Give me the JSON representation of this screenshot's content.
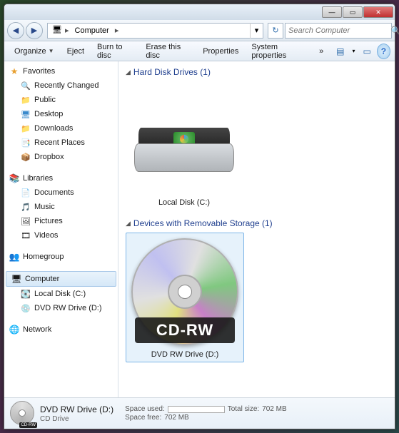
{
  "titlebar": {
    "min": "—",
    "max": "▭",
    "close": "✕"
  },
  "nav": {
    "back": "◀",
    "fwd": "▶",
    "breadcrumb": {
      "root_arrow": "▸",
      "location": "Computer",
      "arrow": "▸"
    },
    "dropdown": "▾",
    "refresh": "↻",
    "search_placeholder": "Search Computer",
    "search_icon": "🔍"
  },
  "toolbar": {
    "organize": "Organize",
    "eject": "Eject",
    "burn": "Burn to disc",
    "erase": "Erase this disc",
    "properties": "Properties",
    "sysprops": "System properties",
    "chevron": "»",
    "view_icon": "▤",
    "view_chevron": "▾",
    "preview_icon": "▭",
    "help_icon": "?"
  },
  "sidebar": {
    "favorites": {
      "label": "Favorites",
      "icon": "★",
      "items": [
        {
          "label": "Recently Changed",
          "icon": "🔍"
        },
        {
          "label": "Public",
          "icon": "📁"
        },
        {
          "label": "Desktop",
          "icon": "🖥"
        },
        {
          "label": "Downloads",
          "icon": "📁"
        },
        {
          "label": "Recent Places",
          "icon": "📑"
        },
        {
          "label": "Dropbox",
          "icon": "📦"
        }
      ]
    },
    "libraries": {
      "label": "Libraries",
      "icon": "📚",
      "items": [
        {
          "label": "Documents",
          "icon": "📄"
        },
        {
          "label": "Music",
          "icon": "🎵"
        },
        {
          "label": "Pictures",
          "icon": "🖼"
        },
        {
          "label": "Videos",
          "icon": "🎞"
        }
      ]
    },
    "homegroup": {
      "label": "Homegroup",
      "icon": "👥"
    },
    "computer": {
      "label": "Computer",
      "icon": "🖥",
      "items": [
        {
          "label": "Local Disk (C:)",
          "icon": "💽"
        },
        {
          "label": "DVD RW Drive (D:)",
          "icon": "💿"
        }
      ]
    },
    "network": {
      "label": "Network",
      "icon": "🌐"
    }
  },
  "content": {
    "hdd_section": "Hard Disk Drives (1)",
    "hdd_item": "Local Disk (C:)",
    "removable_section": "Devices with Removable Storage (1)",
    "cd_item": "DVD RW Drive (D:)",
    "cd_badge": "CD-RW",
    "triangle": "◢"
  },
  "statusbar": {
    "title": "DVD RW Drive (D:)",
    "subtitle": "CD Drive",
    "space_used_label": "Space used:",
    "space_free_label": "Space free:",
    "space_free_value": "702 MB",
    "total_size_label": "Total size:",
    "total_size_value": "702 MB",
    "mini_badge": "CD-RW"
  }
}
